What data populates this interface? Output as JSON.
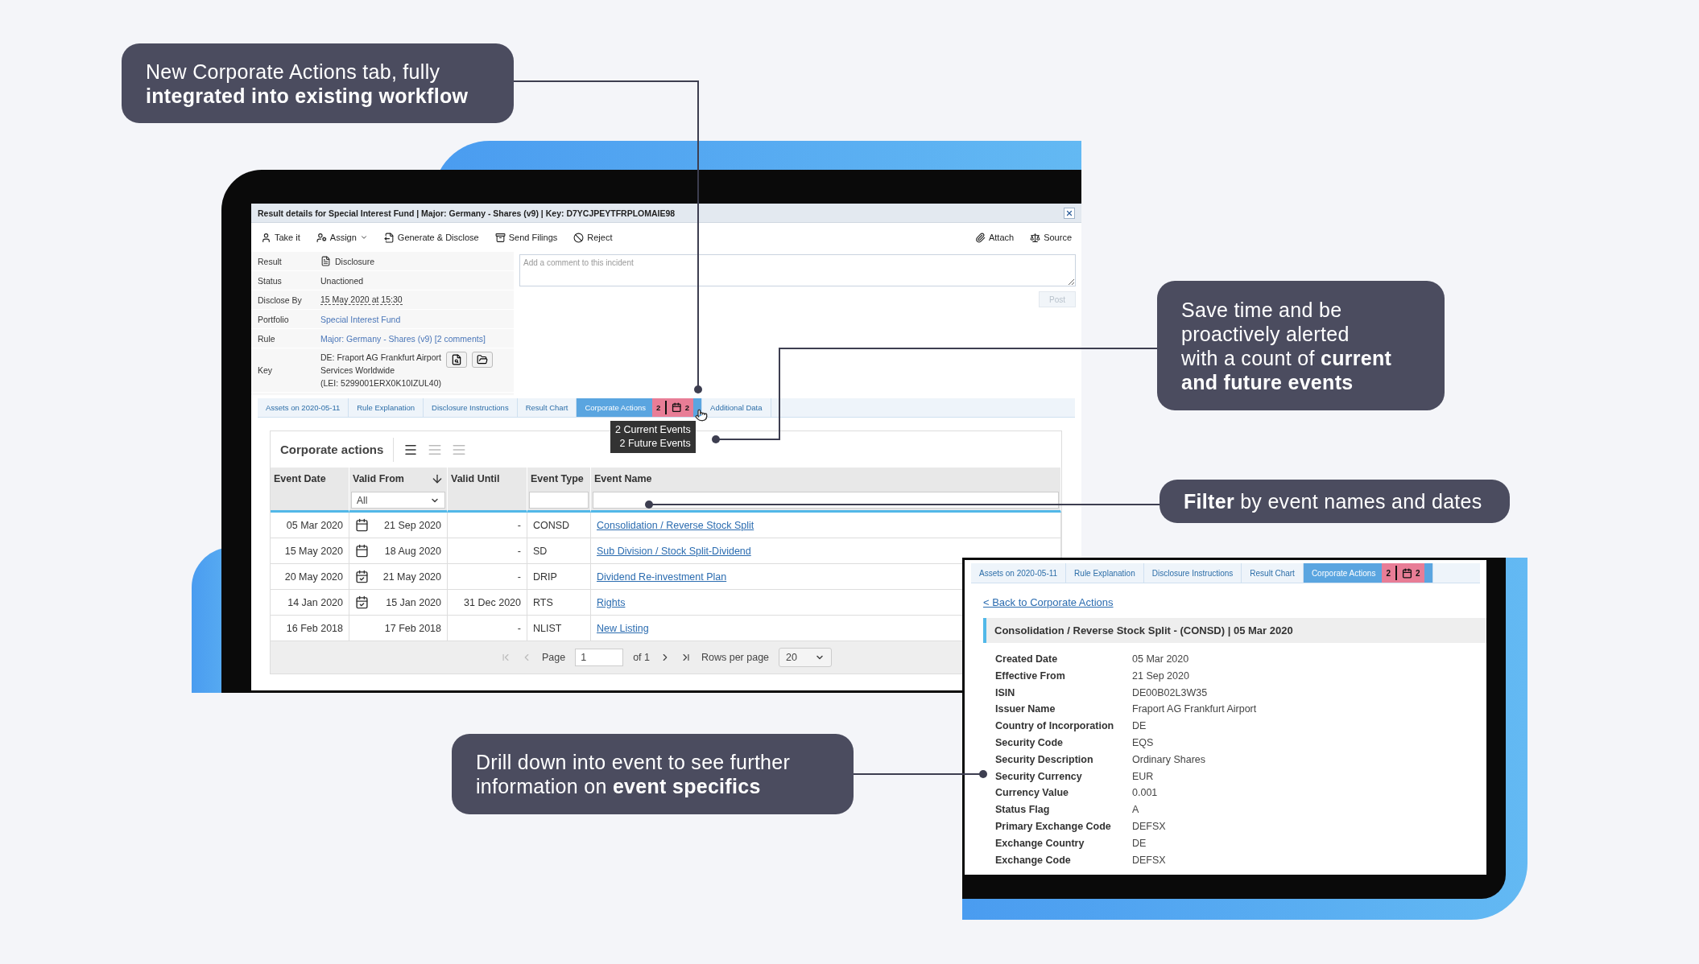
{
  "callouts": [
    {
      "lines": [
        "New Corporate Actions tab, fully",
        "**integrated into existing workflow**"
      ]
    },
    {
      "lines": [
        "Save time and be",
        "proactively alerted",
        "with a count of **current**",
        "**and future events**"
      ]
    },
    {
      "lines": [
        "**Filter** by event names and dates"
      ]
    },
    {
      "lines": [
        "Drill down into event to see further",
        "information on **event specifics**"
      ]
    }
  ],
  "window": {
    "title": "Result details for Special Interest Fund | Major: Germany - Shares (v9) | Key: D7YCJPEYTFRPLOMAIE98"
  },
  "toolbar_left": [
    {
      "label": "Take it",
      "caret": false
    },
    {
      "label": "Assign",
      "caret": true
    },
    {
      "label": "Generate & Disclose",
      "caret": false
    },
    {
      "label": "Send Filings",
      "caret": false
    },
    {
      "label": "Reject",
      "caret": false
    }
  ],
  "toolbar_right": [
    {
      "label": "Attach"
    },
    {
      "label": "Source"
    }
  ],
  "details": [
    {
      "kind": "icon",
      "label": "Result",
      "value": "Disclosure"
    },
    {
      "kind": "text",
      "label": "Status",
      "value": "Unactioned"
    },
    {
      "kind": "dotted",
      "label": "Disclose By",
      "value": "15 May 2020 at 15:30"
    },
    {
      "kind": "link",
      "label": "Portfolio",
      "value": "Special Interest Fund"
    },
    {
      "kind": "rule",
      "label": "Rule",
      "value": "Major: Germany - Shares (v9)",
      "note": "[2 comments]"
    },
    {
      "kind": "key",
      "label": "Key",
      "lines": [
        "DE: Fraport AG Frankfurt Airport",
        "Services Worldwide",
        "(LEI: 5299001ERX0K10IZUL40)"
      ]
    }
  ],
  "comment": {
    "placeholder": "Add a comment to this incident"
  },
  "post_button": {
    "label": "Post",
    "disabled": true
  },
  "tabs": [
    {
      "label": "Assets on 2020-05-11",
      "selected": false
    },
    {
      "label": "Rule Explanation",
      "selected": false
    },
    {
      "label": "Disclosure Instructions",
      "selected": false
    },
    {
      "label": "Result Chart",
      "selected": false
    },
    {
      "label": "Corporate Actions",
      "selected": true,
      "badge": {
        "current": "2",
        "future": "2"
      }
    },
    {
      "label": "Additional Data",
      "selected": false
    }
  ],
  "tooltip": [
    "2 Current Events",
    "2 Future Events"
  ],
  "corporate_actions": {
    "title": "Corporate actions",
    "views": [
      {
        "selected": true
      },
      {
        "selected": false
      },
      {
        "selected": false
      }
    ],
    "columns": [
      "Event Date",
      "Valid From",
      "Valid Until",
      "Event Type",
      "Event Name"
    ],
    "filter": {
      "value": "All"
    },
    "rows": [
      {
        "event_date": "05 Mar 2020",
        "kind": "pending",
        "valid_from": "21 Sep 2020",
        "valid_until": "-",
        "event_type": "CONSD",
        "event_name": "Consolidation / Reverse Stock Split"
      },
      {
        "event_date": "15 May 2020",
        "kind": "pending",
        "valid_from": "18 Aug 2020",
        "valid_until": "-",
        "event_type": "SD",
        "event_name": "Sub Division / Stock Split-Dividend"
      },
      {
        "event_date": "20 May 2020",
        "kind": "done",
        "valid_from": "21 May 2020",
        "valid_until": "-",
        "event_type": "DRIP",
        "event_name": "Dividend Re-investment Plan"
      },
      {
        "event_date": "14 Jan 2020",
        "kind": "done",
        "valid_from": "15 Jan 2020",
        "valid_until": "31 Dec 2020",
        "event_type": "RTS",
        "event_name": "Rights"
      },
      {
        "event_date": "16 Feb 2018",
        "kind": "plain",
        "valid_from": "17 Feb 2018",
        "valid_until": "-",
        "event_type": "NLIST",
        "event_name": "New Listing"
      }
    ],
    "pagination": {
      "page_label": "Page",
      "page": "1",
      "of": "of 1",
      "rows_label": "Rows per page",
      "rows": "20"
    }
  },
  "detail": {
    "tabs": [
      {
        "label": "Assets on 2020-05-11",
        "selected": false
      },
      {
        "label": "Rule Explanation",
        "selected": false
      },
      {
        "label": "Disclosure Instructions",
        "selected": false
      },
      {
        "label": "Result Chart",
        "selected": false
      },
      {
        "label": "Corporate Actions",
        "selected": true,
        "badge": {
          "current": "2",
          "future": "2"
        }
      }
    ],
    "back_link": "< Back to Corporate Actions",
    "heading": "Consolidation / Reverse Stock Split - (CONSD) | 05 Mar 2020",
    "fields": [
      {
        "label": "Created Date",
        "value": "05 Mar 2020"
      },
      {
        "label": "Effective From",
        "value": "21 Sep 2020"
      },
      {
        "label": "ISIN",
        "value": "DE00B02L3W35"
      },
      {
        "label": "Issuer Name",
        "value": "Fraport AG Frankfurt Airport"
      },
      {
        "label": "Country of Incorporation",
        "value": "DE"
      },
      {
        "label": "Security Code",
        "value": "EQS"
      },
      {
        "label": "Security Description",
        "value": "Ordinary Shares"
      },
      {
        "label": "Security Currency",
        "value": "EUR"
      },
      {
        "label": "Currency Value",
        "value": "0.001"
      },
      {
        "label": "Status Flag",
        "value": "A"
      },
      {
        "label": "Primary Exchange Code",
        "value": "DEFSX"
      },
      {
        "label": "Exchange Country",
        "value": "DE"
      },
      {
        "label": "Exchange Code",
        "value": "DEFSX"
      }
    ]
  }
}
